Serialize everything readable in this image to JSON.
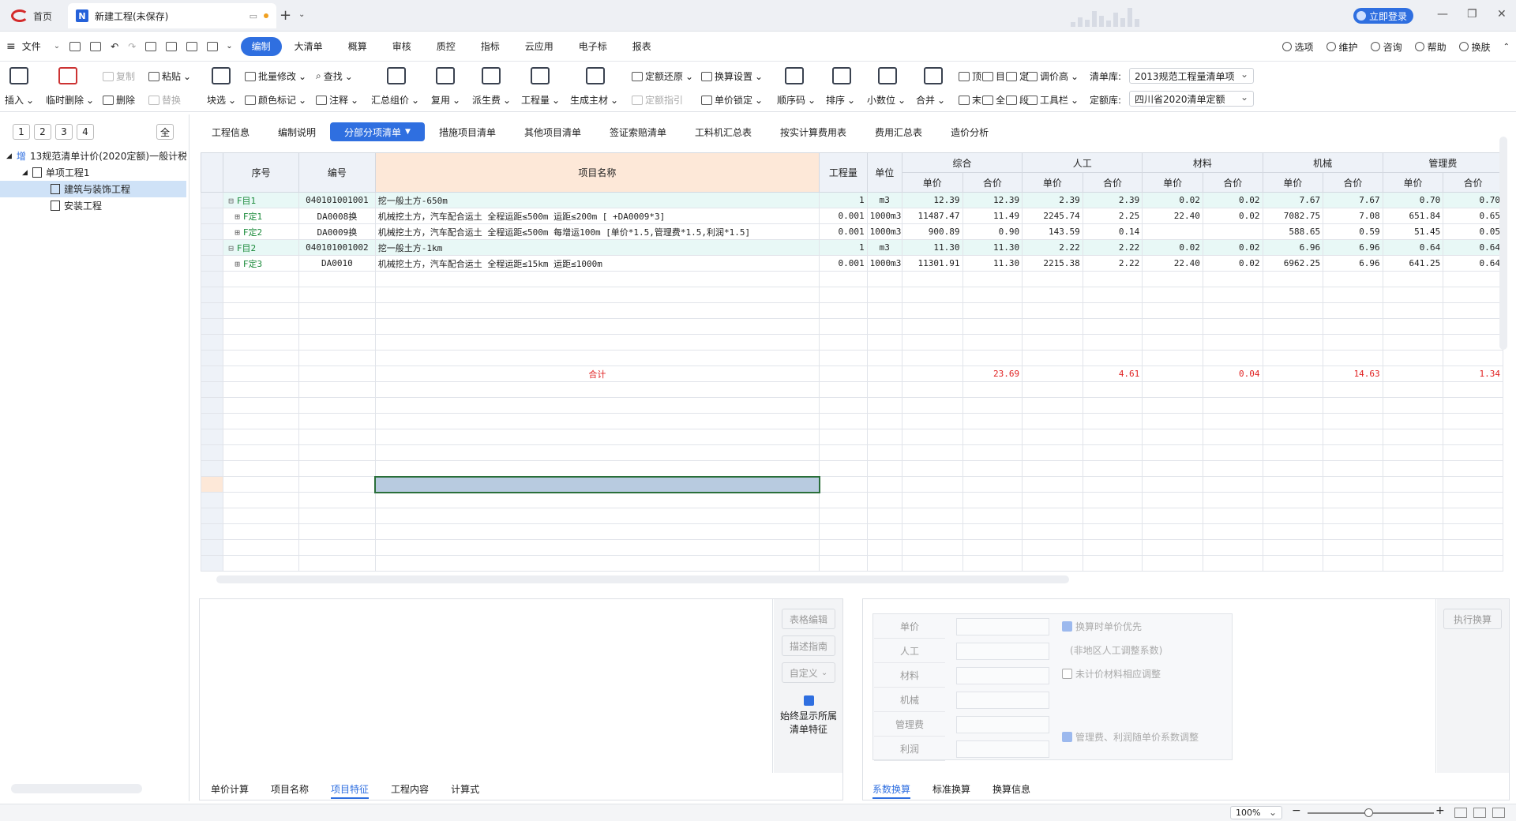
{
  "titlebar": {
    "home_label": "首页",
    "doc_title": "新建工程(未保存)",
    "login_label": "立即登录"
  },
  "menubar": {
    "items": [
      "文件",
      "编制",
      "大清单",
      "概算",
      "审核",
      "质控",
      "指标",
      "云应用",
      "电子标",
      "报表"
    ],
    "right": [
      "选项",
      "维护",
      "咨询",
      "帮助",
      "换肤"
    ]
  },
  "toolbar": {
    "insert": "插入",
    "temp_delete": "临时删除",
    "copy": "复制",
    "delete": "删除",
    "paste": "粘贴",
    "replace": "替换",
    "block_select": "块选",
    "batch_modify": "批量修改",
    "color_mark": "颜色标记",
    "find": "查找",
    "annotate": "注释",
    "summary_group": "汇总组价",
    "reuse": "复用",
    "derive_fee": "派生费",
    "quantity": "工程量",
    "gen_main": "生成主材",
    "quota_restore": "定额还原",
    "convert_setting": "换算设置",
    "quota_guide": "定额指引",
    "price_lock": "单价锁定",
    "seq_code": "顺序码",
    "sort": "排序",
    "decimal": "小数位",
    "merge": "合并",
    "top": "顶",
    "catalog": "目",
    "fix": "定",
    "bottom": "末",
    "all": "全",
    "section": "段",
    "adjust_price": "调价高",
    "tool_bar": "工具栏",
    "list_lib_label": "清单库:",
    "list_lib_value": "2013规范工程量清单项",
    "quota_lib_label": "定额库:",
    "quota_lib_value": "四川省2020清单定额"
  },
  "left": {
    "levels": [
      "1",
      "2",
      "3",
      "4"
    ],
    "all_label": "全",
    "tree": [
      "13规范清单计价(2020定额)一般计税",
      "单项工程1",
      "建筑与装饰工程",
      "安装工程"
    ],
    "root_icon_text": "增"
  },
  "tabs": [
    "工程信息",
    "编制说明",
    "分部分项清单",
    "措施项目清单",
    "其他项目清单",
    "签证索赔清单",
    "工料机汇总表",
    "按实计算费用表",
    "费用汇总表",
    "造价分析"
  ],
  "grid": {
    "headers": {
      "seq": "序号",
      "code": "编号",
      "name": "项目名称",
      "qty": "工程量",
      "unit": "单位",
      "groups": [
        "综合",
        "人工",
        "材料",
        "机械",
        "管理费"
      ],
      "sub": [
        "单价",
        "合价"
      ]
    },
    "rows": [
      {
        "seq": "F目1",
        "code": "040101001001",
        "name": "挖一般土方-650m",
        "qty": "1",
        "unit": "m3",
        "v": [
          "12.39",
          "12.39",
          "2.39",
          "2.39",
          "0.02",
          "0.02",
          "7.67",
          "7.67",
          "0.70",
          "0.70"
        ],
        "hl": true
      },
      {
        "seq": "F定1",
        "code": "DA0008换",
        "name": "机械挖土方，汽车配合运土 全程运距≤500m 运距≤200m [ +DA0009*3]",
        "qty": "0.001",
        "unit": "1000m3",
        "v": [
          "11487.47",
          "11.49",
          "2245.74",
          "2.25",
          "22.40",
          "0.02",
          "7082.75",
          "7.08",
          "651.84",
          "0.65"
        ],
        "hl": false
      },
      {
        "seq": "F定2",
        "code": "DA0009换",
        "name": "机械挖土方，汽车配合运土 全程运距≤500m 每增运100m [单价*1.5,管理费*1.5,利润*1.5]",
        "qty": "0.001",
        "unit": "1000m3",
        "v": [
          "900.89",
          "0.90",
          "143.59",
          "0.14",
          "",
          "",
          "588.65",
          "0.59",
          "51.45",
          "0.05"
        ],
        "hl": false
      },
      {
        "seq": "F目2",
        "code": "040101001002",
        "name": "挖一般土方-1km",
        "qty": "1",
        "unit": "m3",
        "v": [
          "11.30",
          "11.30",
          "2.22",
          "2.22",
          "0.02",
          "0.02",
          "6.96",
          "6.96",
          "0.64",
          "0.64"
        ],
        "hl": true
      },
      {
        "seq": "F定3",
        "code": "DA0010",
        "name": "机械挖土方，汽车配合运土 全程运距≤15km 运距≤1000m",
        "qty": "0.001",
        "unit": "1000m3",
        "v": [
          "11301.91",
          "11.30",
          "2215.38",
          "2.22",
          "22.40",
          "0.02",
          "6962.25",
          "6.96",
          "641.25",
          "0.64"
        ],
        "hl": false
      }
    ],
    "total_label": "合计",
    "totals": [
      "23.69",
      "4.61",
      "0.04",
      "14.63",
      "1.34"
    ]
  },
  "bottom_left": {
    "btn_table_edit": "表格编辑",
    "btn_desc_guide": "描述指南",
    "btn_custom": "自定义",
    "always_show": "始终显示所属清单特征",
    "tabs": [
      "单价计算",
      "项目名称",
      "项目特征",
      "工程内容",
      "计算式"
    ]
  },
  "bottom_right": {
    "fields": [
      "单价",
      "人工",
      "材料",
      "机械",
      "管理费",
      "利润"
    ],
    "opt_price_first": "换算时单价优先",
    "non_local_note": "(非地区人工调整系数)",
    "opt_unpriced": "未计价材料相应调整",
    "opt_mgmt": "管理费、利润随单价系数调整",
    "exec_btn": "执行换算",
    "tabs": [
      "系数换算",
      "标准换算",
      "换算信息"
    ]
  },
  "status": {
    "zoom": "100%"
  }
}
